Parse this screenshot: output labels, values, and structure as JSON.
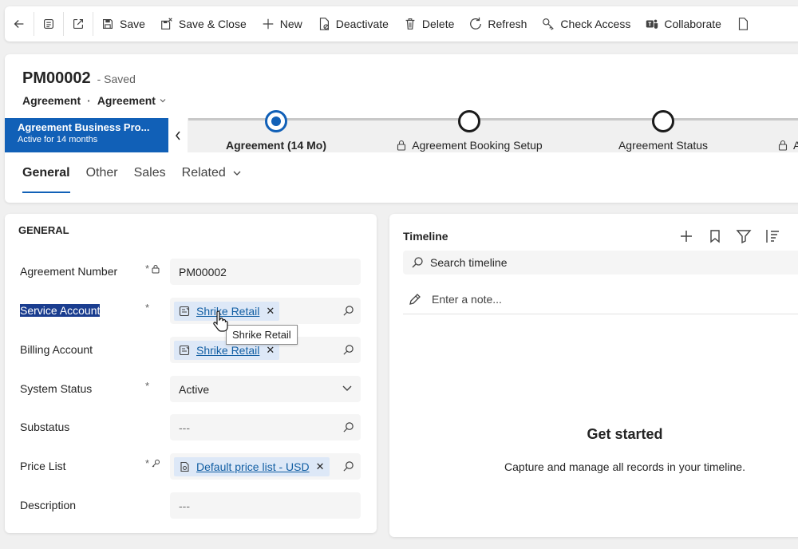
{
  "toolbar": {
    "save": "Save",
    "save_close": "Save & Close",
    "new": "New",
    "deactivate": "Deactivate",
    "delete": "Delete",
    "refresh": "Refresh",
    "check_access": "Check Access",
    "collaborate": "Collaborate"
  },
  "header": {
    "record_name": "PM00002",
    "save_status": "- Saved",
    "entity": "Agreement",
    "form_selector": "Agreement"
  },
  "bpf": {
    "flag_title": "Agreement Business Pro...",
    "flag_sub": "Active for 14 months",
    "stages": [
      {
        "label": "Agreement  (14 Mo)",
        "active": true,
        "locked": false
      },
      {
        "label": "Agreement Booking Setup",
        "active": false,
        "locked": true
      },
      {
        "label": "Agreement Status",
        "active": false,
        "locked": false
      },
      {
        "label": "A",
        "active": false,
        "locked": true
      }
    ]
  },
  "tabs": [
    "General",
    "Other",
    "Sales",
    "Related"
  ],
  "general": {
    "section_title": "GENERAL",
    "fields": {
      "agreement_number": {
        "label": "Agreement Number",
        "value": "PM00002"
      },
      "service_account": {
        "label": "Service Account",
        "value": "Shrike Retail"
      },
      "billing_account": {
        "label": "Billing Account",
        "value": "Shrike Retail"
      },
      "system_status": {
        "label": "System Status",
        "value": "Active"
      },
      "substatus": {
        "label": "Substatus",
        "value": "---"
      },
      "price_list": {
        "label": "Price List",
        "value": "Default price list - USD"
      },
      "description": {
        "label": "Description",
        "value": "---"
      }
    },
    "tooltip": "Shrike Retail"
  },
  "timeline": {
    "title": "Timeline",
    "search_placeholder": "Search timeline",
    "note_placeholder": "Enter a note...",
    "empty_title": "Get started",
    "empty_desc": "Capture and manage all records in your timeline."
  }
}
